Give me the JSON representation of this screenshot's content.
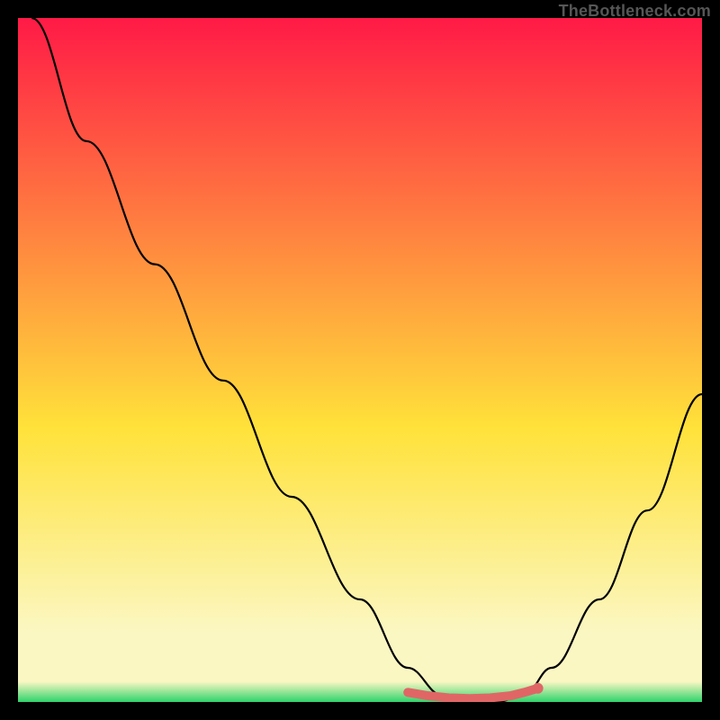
{
  "attribution": "TheBottleneck.com",
  "colors": {
    "top": "#ff1a46",
    "mid": "#ffe23a",
    "cream": "#fbf7c3",
    "green": "#2fd36b",
    "curve": "#000000",
    "marker": "#e06666"
  },
  "chart_data": {
    "type": "line",
    "title": "",
    "xlabel": "",
    "ylabel": "",
    "xlim": [
      0,
      100
    ],
    "ylim": [
      0,
      100
    ],
    "series": [
      {
        "name": "bottleneck-curve",
        "x": [
          2,
          10,
          20,
          30,
          40,
          50,
          57,
          62,
          66,
          70,
          74,
          78,
          85,
          92,
          100
        ],
        "values": [
          100,
          82,
          64,
          47,
          30,
          15,
          5,
          1,
          0,
          0,
          1,
          5,
          15,
          28,
          45
        ]
      }
    ],
    "markers": {
      "name": "optimal-range",
      "x": [
        57,
        60,
        63,
        66,
        69,
        72,
        74,
        76
      ],
      "values": [
        1.4,
        0.9,
        0.6,
        0.5,
        0.6,
        0.9,
        1.4,
        2.0
      ]
    }
  }
}
